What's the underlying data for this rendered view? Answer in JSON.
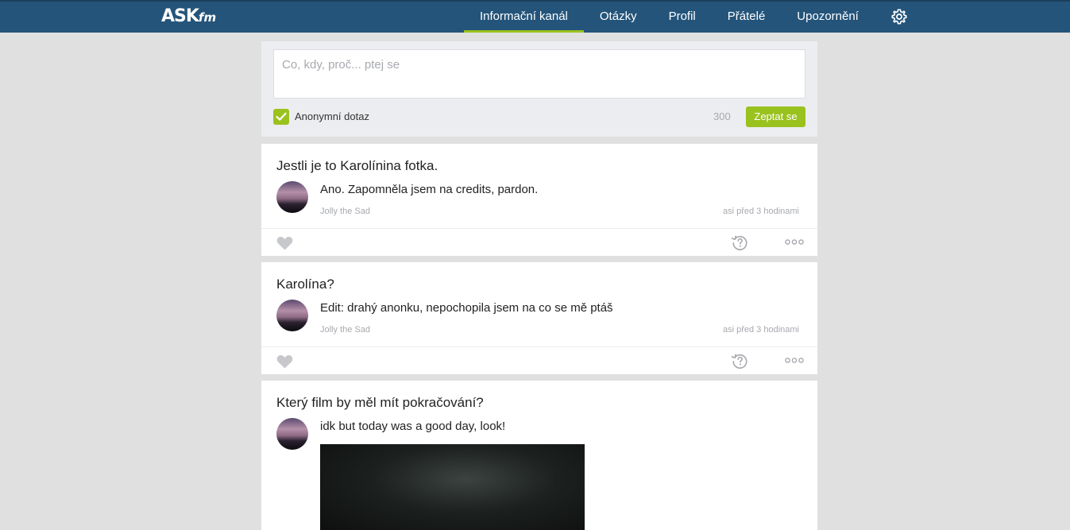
{
  "brand": {
    "logo_main": "ASK",
    "logo_suffix": "fm"
  },
  "nav": {
    "items": [
      {
        "label": "Informační kanál",
        "active": true
      },
      {
        "label": "Otázky",
        "active": false
      },
      {
        "label": "Profil",
        "active": false
      },
      {
        "label": "Přátelé",
        "active": false
      },
      {
        "label": "Upozornění",
        "active": false
      }
    ],
    "settings_icon": "gear-icon"
  },
  "ask": {
    "placeholder": "Co, kdy, proč... ptej se",
    "anonymous_label": "Anonymní dotaz",
    "anonymous_checked": true,
    "char_count": "300",
    "submit_label": "Zeptat se"
  },
  "feed": [
    {
      "question": "Jestli je to Karolínina fotka.",
      "answer": "Ano. Zapomněla jsem na credits, pardon.",
      "author": "Jolly the Sad",
      "time": "asi před 3 hodinami"
    },
    {
      "question": "Karolína?",
      "answer": "Edit: drahý anonku, nepochopila jsem na co se mě ptáš",
      "author": "Jolly the Sad",
      "time": "asi před 3 hodinami"
    },
    {
      "question": "Který film by měl mít pokračování?",
      "answer": "idk but today was a good day, look!"
    }
  ],
  "colors": {
    "header": "#24547a",
    "accent": "#9ac21e",
    "background": "#e0e0e0"
  }
}
